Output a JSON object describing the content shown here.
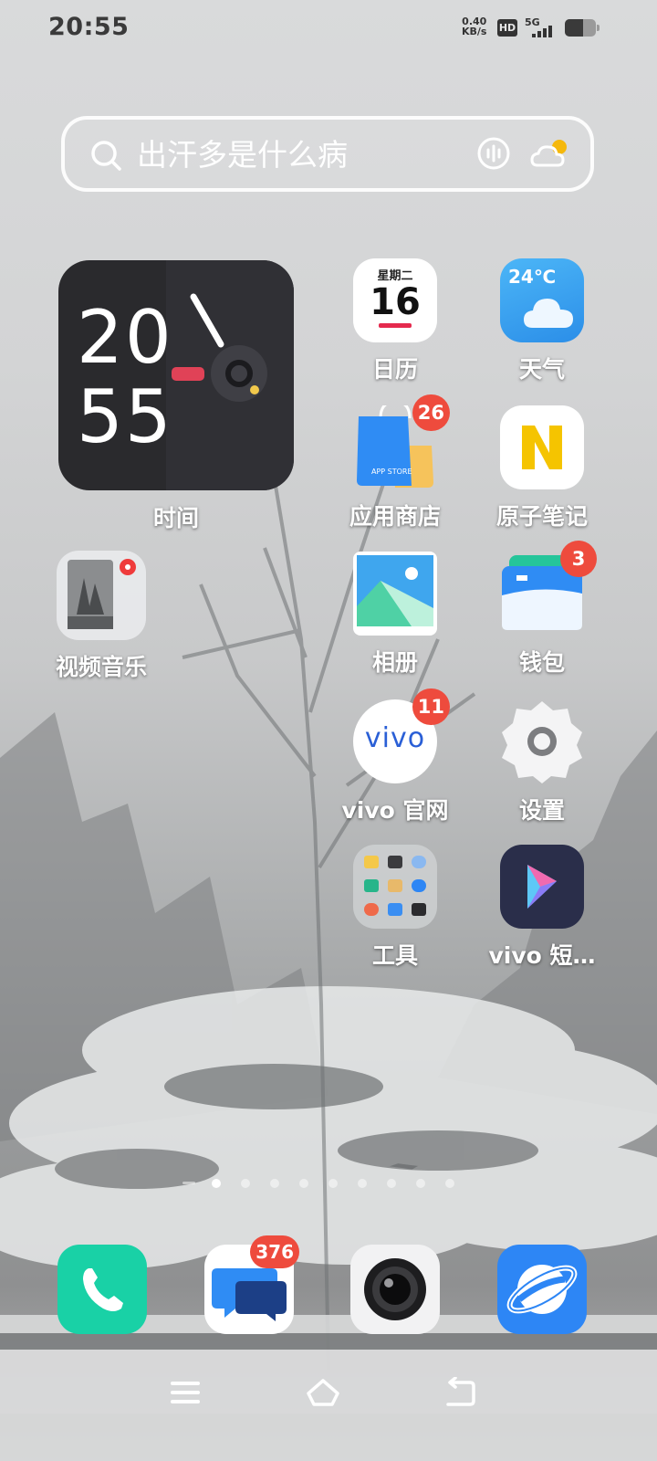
{
  "status_bar": {
    "time": "20:55",
    "net_speed_value": "0.40",
    "net_speed_unit": "KB/s",
    "hd": "HD",
    "network": "5G",
    "battery_level": 0.6
  },
  "search": {
    "placeholder": "出汗多是什么病"
  },
  "clock_widget": {
    "hour": "20",
    "minute": "55",
    "label": "时间"
  },
  "apps": {
    "calendar": {
      "label": "日历",
      "weekday": "星期二",
      "day": "16"
    },
    "weather": {
      "label": "天气",
      "temp": "24℃"
    },
    "appstore": {
      "label": "应用商店",
      "badge": "26",
      "icon_text": "APP STORE"
    },
    "notes": {
      "label": "原子笔记"
    },
    "video_music": {
      "label": "视频音乐"
    },
    "gallery": {
      "label": "相册"
    },
    "wallet": {
      "label": "钱包",
      "badge": "3"
    },
    "vivo_site": {
      "label": "vivo 官网",
      "badge": "11",
      "logo": "vivo"
    },
    "settings": {
      "label": "设置"
    },
    "tools": {
      "label": "工具"
    },
    "vivo_short": {
      "label": "vivo 短…"
    }
  },
  "dock": {
    "messages_badge": "376"
  },
  "pages": {
    "count": 10,
    "current": 1
  },
  "colors": {
    "badge": "#ee4b3d",
    "phone": "#19d1a6",
    "weather": "#3aa3f0",
    "notes": "#f5c400",
    "browser": "#2d86f5"
  }
}
